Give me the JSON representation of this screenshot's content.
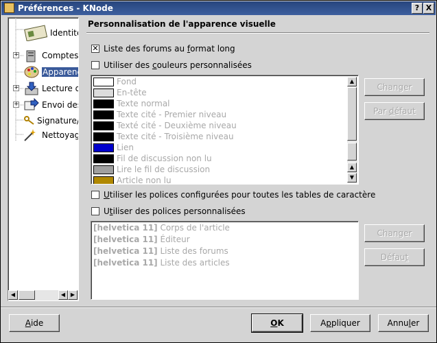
{
  "window": {
    "title": "Préférences - KNode",
    "help_btn": "?",
    "close_btn": "X"
  },
  "tree": {
    "items": [
      {
        "label": "Identités",
        "icon": "identity-card-icon"
      },
      {
        "label": "Comptes",
        "icon": "server-icon"
      },
      {
        "label": "Apparence",
        "icon": "palette-icon"
      },
      {
        "label": "Lecture des",
        "icon": "inbox-icon"
      },
      {
        "label": "Envoi des",
        "icon": "send-icon"
      },
      {
        "label": "Signature/",
        "icon": "key-icon"
      },
      {
        "label": "Nettoyage",
        "icon": "wand-icon"
      }
    ],
    "expander": "+"
  },
  "panel": {
    "heading": "Personnalisation de l'apparence visuelle",
    "long_format": {
      "pre": "Liste des forums au ",
      "u": "f",
      "post": "ormat long",
      "checked": true
    },
    "custom_colors": {
      "pre": "Utiliser des ",
      "u": "c",
      "post": "ouleurs personnalisées",
      "checked": false
    },
    "colors": [
      {
        "name": "Fond",
        "color": "#ffffff"
      },
      {
        "name": "En-tête",
        "color": "#dcdcdc"
      },
      {
        "name": "Texte normal",
        "color": "#000000"
      },
      {
        "name": "Texte cité - Premier niveau",
        "color": "#000000"
      },
      {
        "name": "Texté cité - Deuxième niveau",
        "color": "#000000"
      },
      {
        "name": "Texte cité - Troisième niveau",
        "color": "#000000"
      },
      {
        "name": "Lien",
        "color": "#0000cc"
      },
      {
        "name": "Fil de discussion non lu",
        "color": "#000000"
      },
      {
        "name": "Lire le fil de discussion",
        "color": "#a0a0a0"
      },
      {
        "name": "Article non lu",
        "color": "#b08800"
      }
    ],
    "color_change_btn": "Changer",
    "color_default_btn": {
      "pre": "Par ",
      "u": "d",
      "post": "éfaut"
    },
    "charset_fonts": {
      "pre": "",
      "u": "U",
      "post": "tiliser les polices configurées pour toutes les tables de caractère",
      "checked": false
    },
    "custom_fonts": {
      "pre": "U",
      "u": "t",
      "post": "iliser des polices personnalisées",
      "checked": false
    },
    "fonts": [
      {
        "font": "[helvetica 11]",
        "name": "Corps de l'article"
      },
      {
        "font": "[helvetica 11]",
        "name": "Éditeur"
      },
      {
        "font": "[helvetica 11]",
        "name": "Liste des forums"
      },
      {
        "font": "[helvetica 11]",
        "name": "Liste des articles"
      }
    ],
    "font_change_btn": "Changer",
    "font_default_btn": {
      "pre": "Défau",
      "u": "t",
      "post": ""
    }
  },
  "buttons": {
    "help": {
      "pre": "",
      "u": "A",
      "post": "ide"
    },
    "ok": {
      "pre": "",
      "u": "O",
      "post": "K"
    },
    "apply": {
      "pre": "A",
      "u": "p",
      "post": "pliquer"
    },
    "cancel": {
      "pre": "Annu",
      "u": "l",
      "post": "er"
    }
  }
}
